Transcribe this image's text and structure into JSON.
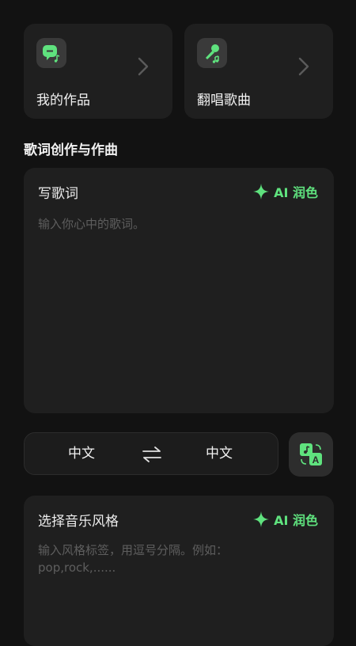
{
  "colors": {
    "background": "#121212",
    "card": "#1f1f1f",
    "accent_green": "#5fe27e",
    "placeholder": "#5e5e5e",
    "text": "#f2f2f2"
  },
  "top_cards": [
    {
      "label": "我的作品",
      "icon": "lyrics-note-icon"
    },
    {
      "label": "翻唱歌曲",
      "icon": "microphone-icon"
    }
  ],
  "section_title": "歌词创作与作曲",
  "lyrics": {
    "label": "写歌词",
    "ai_button": "AI 润色",
    "placeholder": "输入你心中的歌词。"
  },
  "language": {
    "source": "中文",
    "target": "中文",
    "swap_icon": "swap-arrows-icon",
    "translate_icon": "translate-icon"
  },
  "style": {
    "label": "选择音乐风格",
    "ai_button": "AI 润色",
    "placeholder": "输入风格标签，用逗号分隔。例如：pop,rock,......"
  }
}
